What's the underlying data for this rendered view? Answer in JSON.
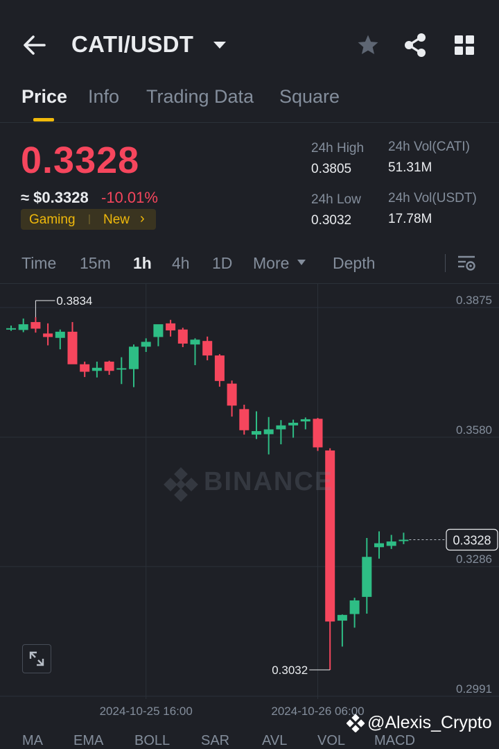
{
  "header": {
    "title": "CATI/USDT",
    "icons": [
      "back-icon",
      "chevron-down-icon",
      "star-icon",
      "share-icon",
      "grid-icon"
    ]
  },
  "tabs": [
    {
      "label": "Price",
      "active": true
    },
    {
      "label": "Info",
      "active": false
    },
    {
      "label": "Trading Data",
      "active": false
    },
    {
      "label": "Square",
      "active": false
    }
  ],
  "price": {
    "last": "0.3328",
    "usd": "≈ $0.3328",
    "change": "-10.01%",
    "tag_category": "Gaming",
    "tag_new": "New",
    "color_down": "#f6465d",
    "color_up": "#2ebd85",
    "accent": "#f0b90b"
  },
  "stats": {
    "high_label": "24h High",
    "high_value": "0.3805",
    "low_label": "24h Low",
    "low_value": "0.3032",
    "vol_base_label": "24h Vol(CATI)",
    "vol_base_value": "51.31M",
    "vol_quote_label": "24h Vol(USDT)",
    "vol_quote_value": "17.78M"
  },
  "timeframes": [
    {
      "label": "Time",
      "active": false
    },
    {
      "label": "15m",
      "active": false
    },
    {
      "label": "1h",
      "active": true
    },
    {
      "label": "4h",
      "active": false
    },
    {
      "label": "1D",
      "active": false
    },
    {
      "label": "More",
      "active": false
    },
    {
      "label": "Depth",
      "active": false
    }
  ],
  "chart": {
    "watermark": "BINANCE",
    "credit": "@Alexis_Crypto",
    "bottom_indicators": [
      "MA",
      "EMA",
      "BOLL",
      "SAR",
      "AVL",
      "VOL",
      "MACD"
    ]
  },
  "chart_data": {
    "type": "candlestick",
    "interval": "1h",
    "yticks": [
      0.3875,
      0.358,
      0.3286,
      0.2991
    ],
    "xticks": [
      "2024-10-25 16:00",
      "2024-10-26 06:00"
    ],
    "current_price": "0.3328",
    "high_marker": "0.3834",
    "low_marker": "0.3032",
    "candles": [
      {
        "o": 0.3809,
        "h": 0.3815,
        "l": 0.3803,
        "c": 0.3809
      },
      {
        "o": 0.3805,
        "h": 0.3831,
        "l": 0.38,
        "c": 0.3818
      },
      {
        "o": 0.3823,
        "h": 0.3834,
        "l": 0.3799,
        "c": 0.3808
      },
      {
        "o": 0.3797,
        "h": 0.382,
        "l": 0.377,
        "c": 0.3789
      },
      {
        "o": 0.3787,
        "h": 0.3806,
        "l": 0.3761,
        "c": 0.3801
      },
      {
        "o": 0.3801,
        "h": 0.3823,
        "l": 0.3751,
        "c": 0.3727
      },
      {
        "o": 0.3727,
        "h": 0.3733,
        "l": 0.3698,
        "c": 0.371
      },
      {
        "o": 0.3712,
        "h": 0.3733,
        "l": 0.3697,
        "c": 0.3719
      },
      {
        "o": 0.3733,
        "h": 0.3735,
        "l": 0.3703,
        "c": 0.3712
      },
      {
        "o": 0.3716,
        "h": 0.3743,
        "l": 0.3682,
        "c": 0.3718
      },
      {
        "o": 0.3716,
        "h": 0.3772,
        "l": 0.3675,
        "c": 0.3767
      },
      {
        "o": 0.3767,
        "h": 0.3786,
        "l": 0.3755,
        "c": 0.3778
      },
      {
        "o": 0.3789,
        "h": 0.3812,
        "l": 0.3768,
        "c": 0.3818
      },
      {
        "o": 0.382,
        "h": 0.3828,
        "l": 0.379,
        "c": 0.3804
      },
      {
        "o": 0.3806,
        "h": 0.381,
        "l": 0.3766,
        "c": 0.3774
      },
      {
        "o": 0.3772,
        "h": 0.3786,
        "l": 0.3725,
        "c": 0.3783
      },
      {
        "o": 0.378,
        "h": 0.379,
        "l": 0.3736,
        "c": 0.3747
      },
      {
        "o": 0.3747,
        "h": 0.375,
        "l": 0.3676,
        "c": 0.3689
      },
      {
        "o": 0.3683,
        "h": 0.369,
        "l": 0.3608,
        "c": 0.3633
      },
      {
        "o": 0.3625,
        "h": 0.3635,
        "l": 0.3567,
        "c": 0.3577
      },
      {
        "o": 0.3567,
        "h": 0.362,
        "l": 0.3557,
        "c": 0.3575
      },
      {
        "o": 0.3568,
        "h": 0.3607,
        "l": 0.3522,
        "c": 0.3579
      },
      {
        "o": 0.3579,
        "h": 0.36,
        "l": 0.3545,
        "c": 0.3588
      },
      {
        "o": 0.3588,
        "h": 0.3601,
        "l": 0.356,
        "c": 0.3594
      },
      {
        "o": 0.3597,
        "h": 0.3606,
        "l": 0.3579,
        "c": 0.3602
      },
      {
        "o": 0.3603,
        "h": 0.3605,
        "l": 0.353,
        "c": 0.3538
      },
      {
        "o": 0.3531,
        "h": 0.3536,
        "l": 0.3032,
        "c": 0.3142
      },
      {
        "o": 0.3144,
        "h": 0.3158,
        "l": 0.3085,
        "c": 0.3157
      },
      {
        "o": 0.3159,
        "h": 0.3196,
        "l": 0.3128,
        "c": 0.319
      },
      {
        "o": 0.3198,
        "h": 0.3332,
        "l": 0.316,
        "c": 0.3289
      },
      {
        "o": 0.3311,
        "h": 0.3347,
        "l": 0.3285,
        "c": 0.332
      },
      {
        "o": 0.3314,
        "h": 0.3339,
        "l": 0.3307,
        "c": 0.3324
      },
      {
        "o": 0.3328,
        "h": 0.3344,
        "l": 0.3318,
        "c": 0.3328
      }
    ]
  }
}
